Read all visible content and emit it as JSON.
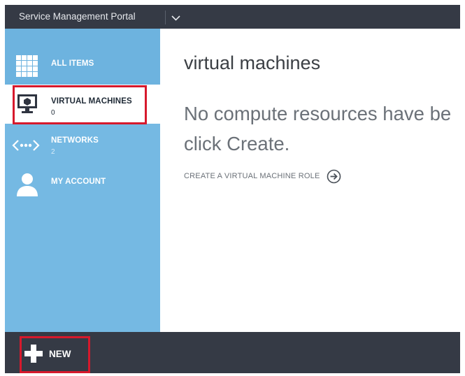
{
  "header": {
    "title": "Service Management Portal",
    "dropdown_icon": "chevron-down-icon"
  },
  "sidebar": {
    "items": [
      {
        "label": "ALL ITEMS",
        "count": "",
        "icon": "grid-icon"
      },
      {
        "label": "VIRTUAL MACHINES",
        "count": "0",
        "icon": "monitor-icon",
        "selected": true
      },
      {
        "label": "NETWORKS",
        "count": "2",
        "icon": "network-icon"
      },
      {
        "label": "MY ACCOUNT",
        "count": "",
        "icon": "user-icon"
      }
    ]
  },
  "main": {
    "title": "virtual machines",
    "empty_line1": "No compute resources have be",
    "empty_line2": "click Create.",
    "create_link": "CREATE A VIRTUAL MACHINE ROLE",
    "create_icon": "arrow-right-circle-icon"
  },
  "footer": {
    "new_label": "NEW",
    "new_icon": "plus-icon"
  },
  "colors": {
    "topbar": "#353a45",
    "sidebar": "#75b9e3",
    "highlight": "#d7192c",
    "selected_bg": "#ffffff"
  }
}
